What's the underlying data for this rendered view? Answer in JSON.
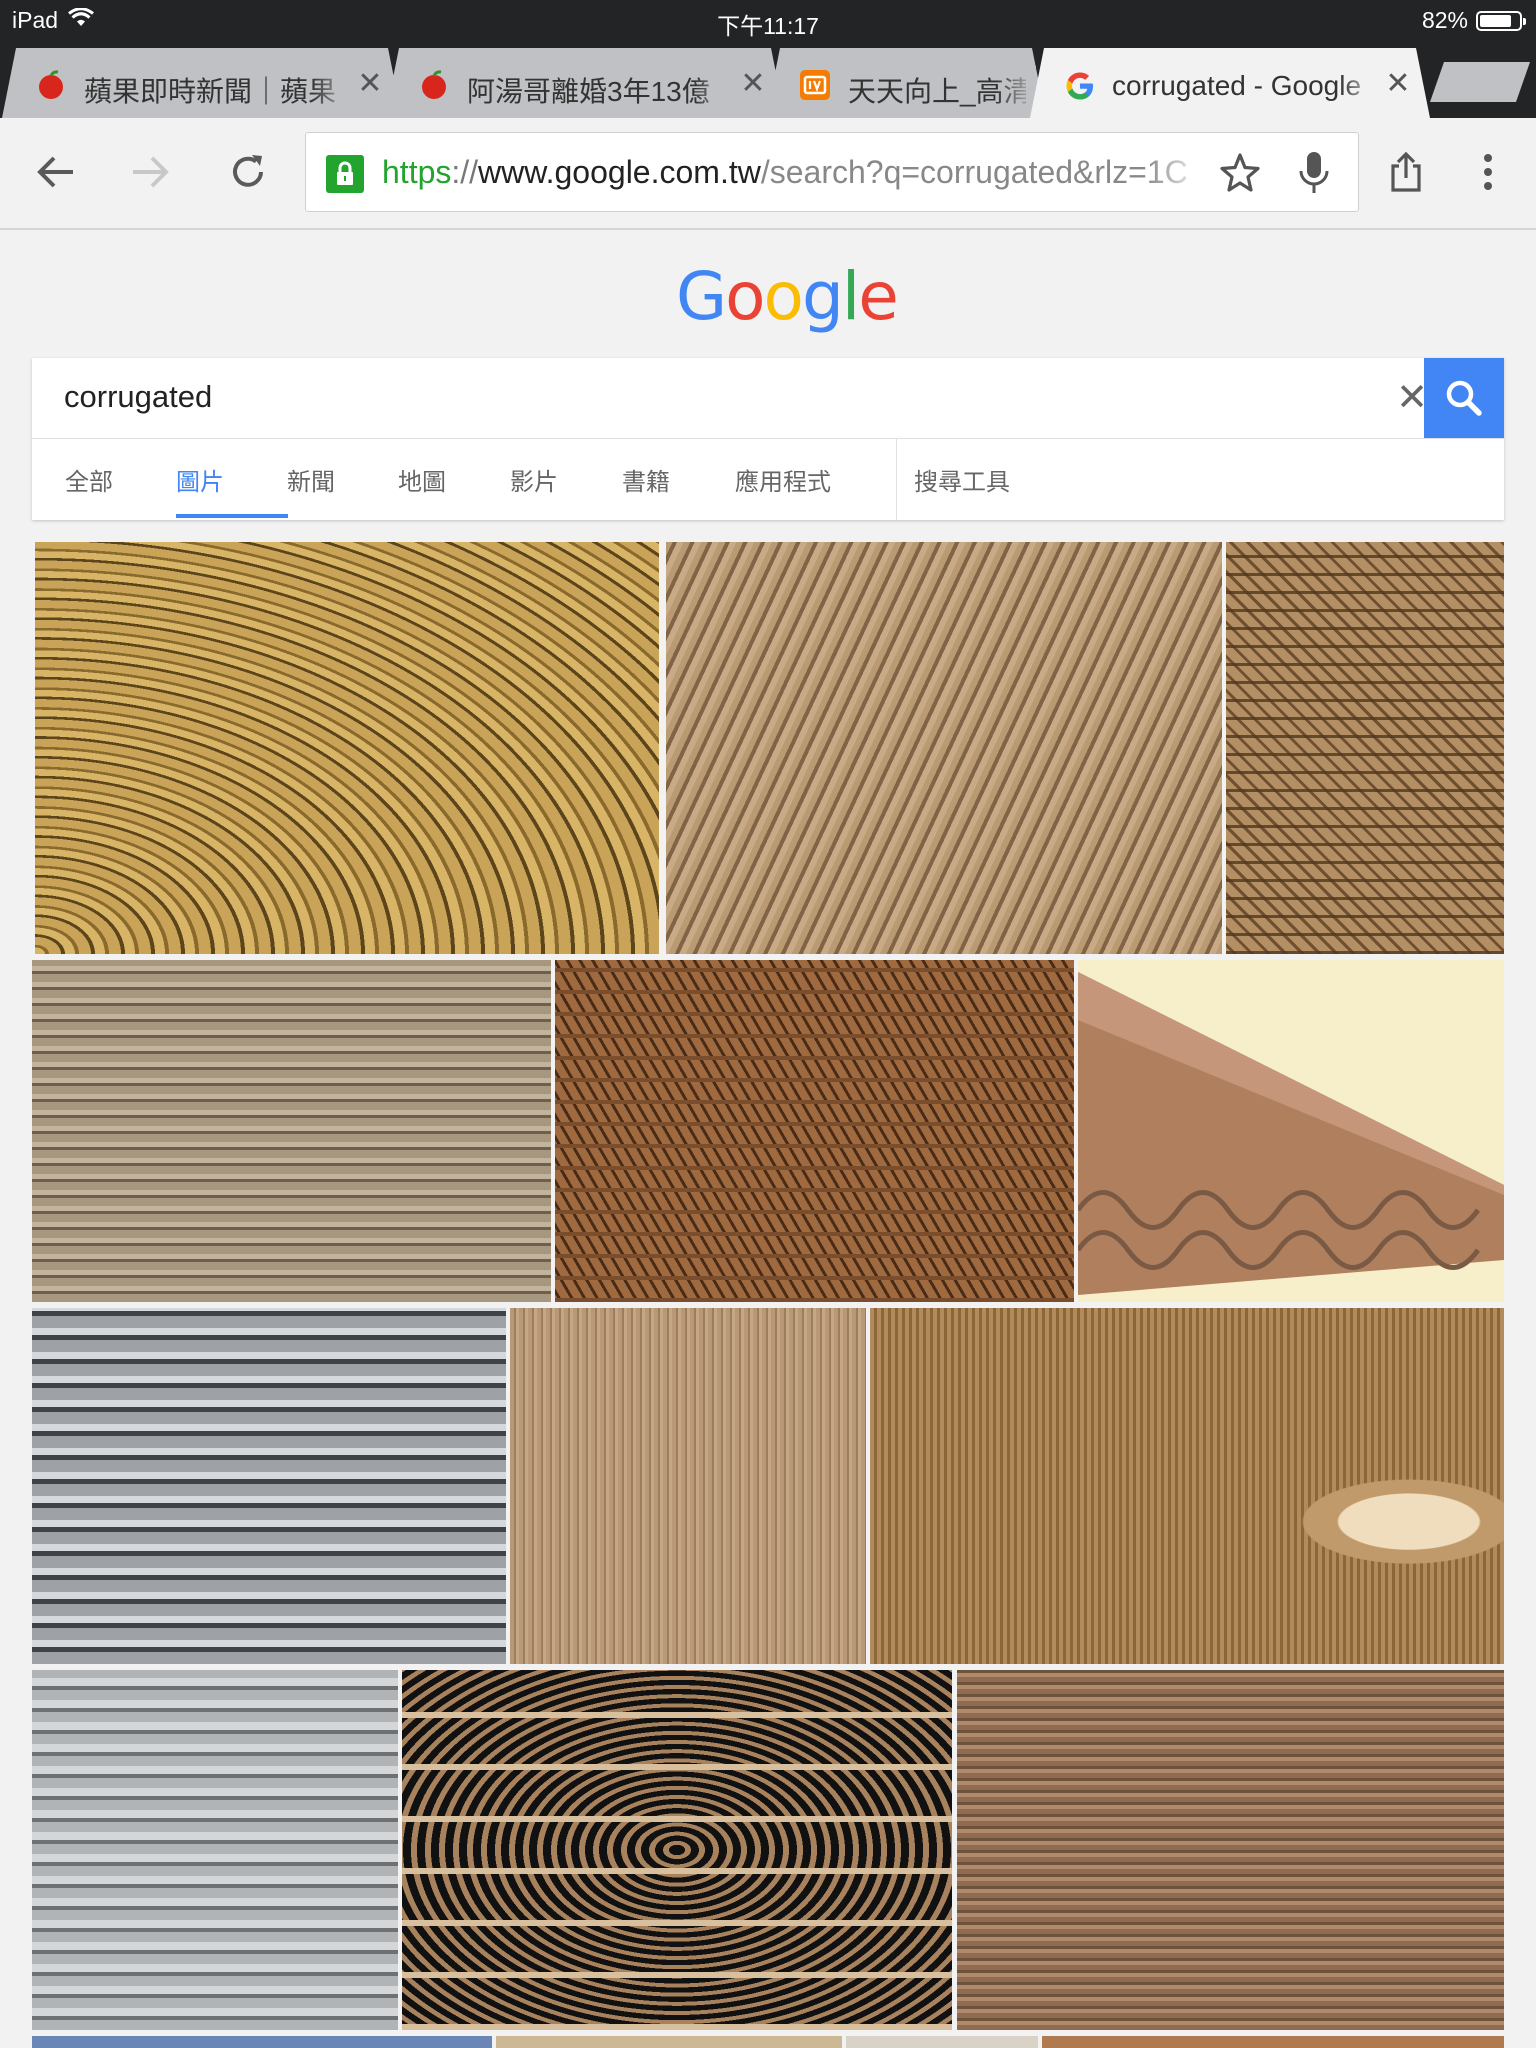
{
  "status_bar": {
    "device": "iPad",
    "time": "下午11:17",
    "battery": "82%",
    "battery_level": 0.82
  },
  "tabs": [
    {
      "title": "蘋果即時新聞｜蘋果",
      "favicon": "apple-icon",
      "active": false
    },
    {
      "title": "阿湯哥離婚3年13億",
      "favicon": "apple-icon",
      "active": false
    },
    {
      "title": "天天向上_高清",
      "favicon": "video-app-icon",
      "active": false
    },
    {
      "title": "corrugated - Google",
      "favicon": "google-g-icon",
      "active": true
    }
  ],
  "omnibox": {
    "scheme": "https",
    "separator": "://",
    "host": "www.google.com.tw",
    "path": "/search?q=corrugated&rlz=1C"
  },
  "google": {
    "logo_letters": [
      "G",
      "o",
      "o",
      "g",
      "l",
      "e"
    ],
    "logo_colors": [
      "#4285f4",
      "#ea4335",
      "#fbbc05",
      "#4285f4",
      "#34a853",
      "#ea4335"
    ]
  },
  "search": {
    "query": "corrugated"
  },
  "nav_tabs": [
    "全部",
    "圖片",
    "新聞",
    "地圖",
    "影片",
    "書籍",
    "應用程式"
  ],
  "nav_active_index": 1,
  "search_tools_label": "搜尋工具",
  "colors": {
    "accent": "#4285f4",
    "secure": "#23a42f",
    "chrome_dark": "#222426"
  }
}
